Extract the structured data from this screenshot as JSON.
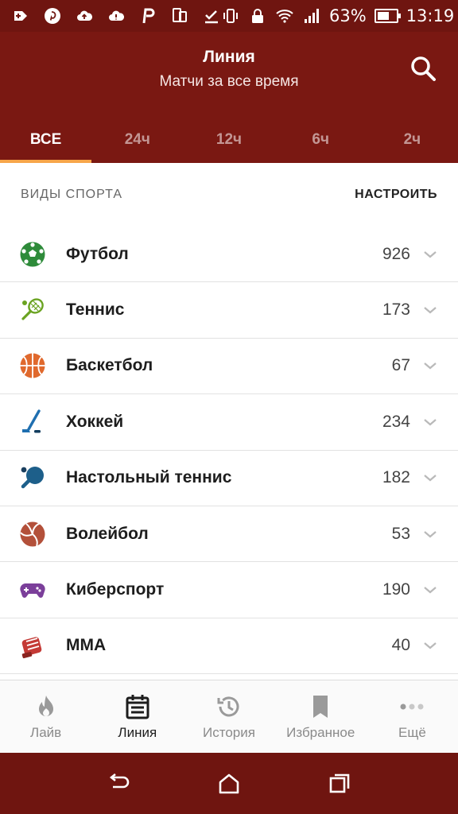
{
  "status_bar": {
    "battery_percent": "63%",
    "battery_level": 0.63,
    "time": "13:19",
    "icons": [
      "add-icon",
      "pinterest-icon",
      "cloud-upload-icon",
      "cloud-alert-icon",
      "parking-icon",
      "phone-copy-icon",
      "check-download-icon",
      "vibrate-icon",
      "lock-icon",
      "wifi-icon",
      "signal-icon",
      "battery-icon"
    ]
  },
  "header": {
    "title": "Линия",
    "subtitle": "Матчи за все время"
  },
  "tabs": [
    {
      "label": "ВСЕ",
      "active": true
    },
    {
      "label": "24ч",
      "active": false
    },
    {
      "label": "12ч",
      "active": false
    },
    {
      "label": "6ч",
      "active": false
    },
    {
      "label": "2ч",
      "active": false
    }
  ],
  "section": {
    "title": "ВИДЫ СПОРТА",
    "configure_label": "НАСТРОИТЬ"
  },
  "sports": [
    {
      "name": "Футбол",
      "count": "926",
      "icon": "soccer-ball-icon",
      "color": "#2e8b3a"
    },
    {
      "name": "Теннис",
      "count": "173",
      "icon": "tennis-racket-icon",
      "color": "#6aa321"
    },
    {
      "name": "Баскетбол",
      "count": "67",
      "icon": "basketball-icon",
      "color": "#e0692d"
    },
    {
      "name": "Хоккей",
      "count": "234",
      "icon": "hockey-stick-icon",
      "color": "#1f6fb0"
    },
    {
      "name": "Настольный теннис",
      "count": "182",
      "icon": "ping-pong-icon",
      "color": "#1d5f8a"
    },
    {
      "name": "Волейбол",
      "count": "53",
      "icon": "volleyball-icon",
      "color": "#b3503a"
    },
    {
      "name": "Киберспорт",
      "count": "190",
      "icon": "gamepad-icon",
      "color": "#7b3f9a"
    },
    {
      "name": "ММА",
      "count": "40",
      "icon": "mma-glove-icon",
      "color": "#c43a36"
    }
  ],
  "bottom_nav": [
    {
      "label": "Лайв",
      "icon": "flame-icon",
      "active": false
    },
    {
      "label": "Линия",
      "icon": "calendar-list-icon",
      "active": true
    },
    {
      "label": "История",
      "icon": "history-icon",
      "active": false
    },
    {
      "label": "Избранное",
      "icon": "bookmark-icon",
      "active": false
    },
    {
      "label": "Ещё",
      "icon": "more-dots-icon",
      "active": false
    }
  ],
  "colors": {
    "header_bg": "#7a1812",
    "status_bg": "#6f1510",
    "tab_indicator": "#f7a64a"
  }
}
